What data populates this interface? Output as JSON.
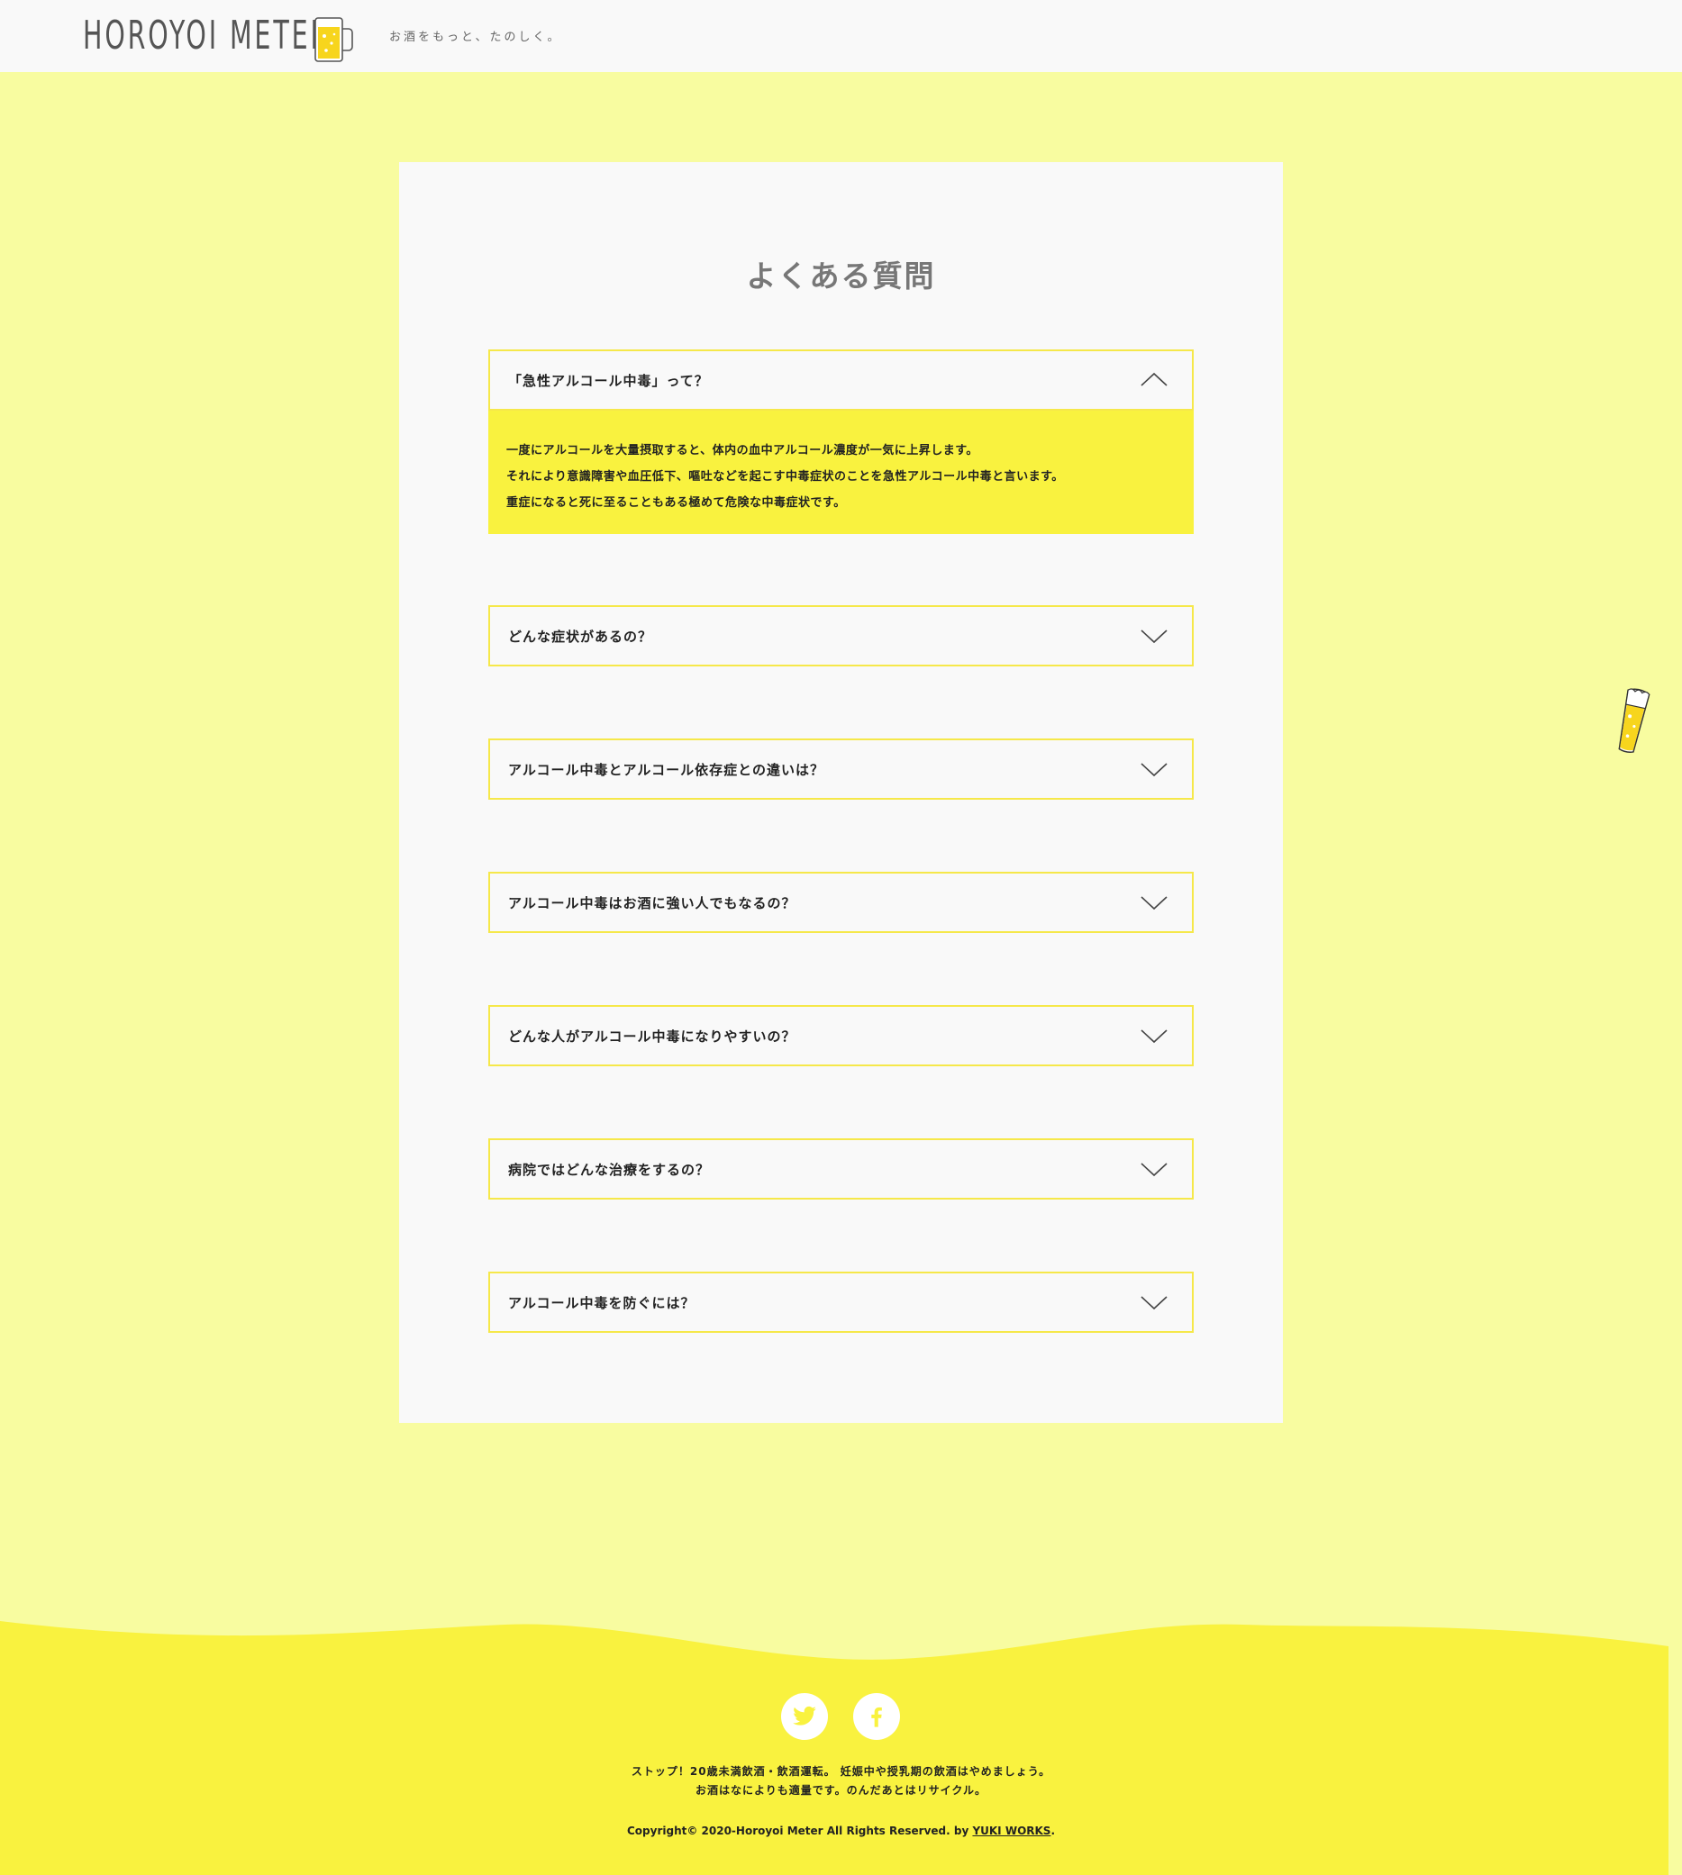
{
  "header": {
    "logo_text": "HOROYOI METER",
    "tagline": "お酒をもっと、たのしく。"
  },
  "faq": {
    "title": "よくある質問",
    "items": [
      {
        "question": "「急性アルコール中毒」って？",
        "expanded": true,
        "answer_lines": [
          "一度にアルコールを大量摂取すると、体内の血中アルコール濃度が一気に上昇します。",
          "それにより意識障害や血圧低下、嘔吐などを起こす中毒症状のことを急性アルコール中毒と言います。",
          "重症になると死に至ることもある極めて危険な中毒症状です。"
        ]
      },
      {
        "question": "どんな症状があるの？",
        "expanded": false
      },
      {
        "question": "アルコール中毒とアルコール依存症との違いは？",
        "expanded": false
      },
      {
        "question": "アルコール中毒はお酒に強い人でもなるの？",
        "expanded": false
      },
      {
        "question": "どんな人がアルコール中毒になりやすいの？",
        "expanded": false
      },
      {
        "question": "病院ではどんな治療をするの？",
        "expanded": false
      },
      {
        "question": "アルコール中毒を防ぐには？",
        "expanded": false
      }
    ]
  },
  "footer": {
    "social": [
      "twitter-icon",
      "facebook-icon"
    ],
    "note_line1": "ストップ！20歳未満飲酒・飲酒運転。 妊娠中や授乳期の飲酒はやめましょう。",
    "note_line2": "お酒はなによりも適量です。のんだあとはリサイクル。",
    "copyright_prefix": "Copyright© 2020-Horoyoi Meter All Rights Reserved. by ",
    "copyright_link": "YUKI WORKS",
    "copyright_suffix": "."
  },
  "colors": {
    "background": "#f8fca0",
    "accent_yellow": "#f9f23f",
    "border_yellow": "#f6e84a",
    "card": "#f9f9f9"
  }
}
